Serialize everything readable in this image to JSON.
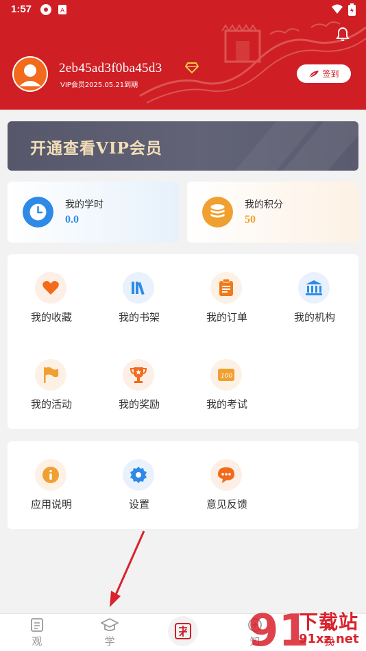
{
  "status": {
    "time": "1:57"
  },
  "profile": {
    "username": "2eb45ad3f0ba45d3",
    "vip_expire": "VIP会员2025.05.21到期",
    "checkin_label": "签到"
  },
  "vip_banner": {
    "text": "开通查看VIP会员"
  },
  "stats": {
    "hours": {
      "label": "我的学时",
      "value": "0.0",
      "color": "#2e8ae6"
    },
    "points": {
      "label": "我的积分",
      "value": "50",
      "color": "#f0a030"
    }
  },
  "menu_main": [
    {
      "label": "我的收藏",
      "icon": "heart-icon"
    },
    {
      "label": "我的书架",
      "icon": "bookshelf-icon"
    },
    {
      "label": "我的订单",
      "icon": "order-icon"
    },
    {
      "label": "我的机构",
      "icon": "institution-icon"
    },
    {
      "label": "我的活动",
      "icon": "flag-icon"
    },
    {
      "label": "我的奖励",
      "icon": "trophy-icon"
    },
    {
      "label": "我的考试",
      "icon": "exam-icon"
    }
  ],
  "menu_secondary": [
    {
      "label": "应用说明",
      "icon": "info-icon"
    },
    {
      "label": "设置",
      "icon": "gear-icon"
    },
    {
      "label": "意见反馈",
      "icon": "feedback-icon"
    }
  ],
  "bottom_nav": [
    {
      "label": "观",
      "icon": "document-icon"
    },
    {
      "label": "学",
      "icon": "graduation-cap-icon"
    },
    {
      "label": "知",
      "icon": "knowledge-icon"
    },
    {
      "label": "我",
      "icon": "user-icon"
    }
  ],
  "watermark": {
    "main": "下载站",
    "sub": "91xz.net"
  },
  "colors": {
    "brand_red": "#cf1f25",
    "orange": "#f07a1a",
    "blue": "#2e8ae6"
  }
}
